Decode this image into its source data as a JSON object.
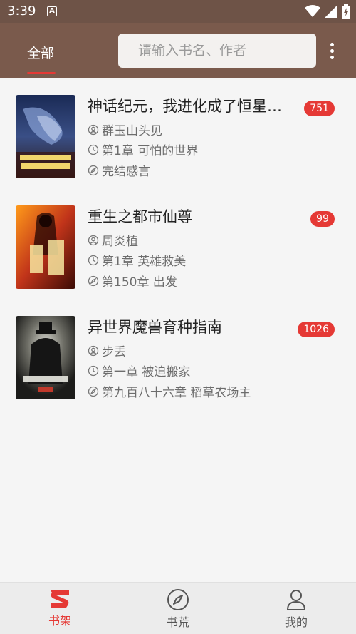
{
  "status_bar": {
    "time": "3:39",
    "icons": [
      "a-icon",
      "wifi-icon",
      "signal-icon",
      "battery-icon"
    ]
  },
  "header": {
    "tab_label": "全部",
    "search_placeholder": "请输入书名、作者",
    "accent_color": "#e53935"
  },
  "books": [
    {
      "title": "神话纪元，我进化成了恒星…",
      "author": "群玉山头见",
      "last_read": "第1章 可怕的世界",
      "latest": "完结感言",
      "badge": "751"
    },
    {
      "title": "重生之都市仙尊",
      "author": "周炎植",
      "last_read": "第1章 英雄救美",
      "latest": "第150章 出发",
      "badge": "99"
    },
    {
      "title": "异世界魔兽育种指南",
      "author": "步丢",
      "last_read": "第一章 被迫搬家",
      "latest": "第九百八十六章 稻草农场主",
      "badge": "1026"
    }
  ],
  "bottom_nav": [
    {
      "label": "书架",
      "icon": "bookshelf-icon",
      "active": true
    },
    {
      "label": "书荒",
      "icon": "compass-icon",
      "active": false
    },
    {
      "label": "我的",
      "icon": "user-icon",
      "active": false
    }
  ]
}
